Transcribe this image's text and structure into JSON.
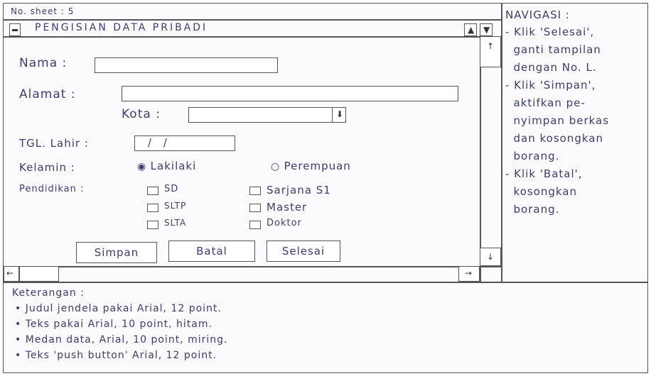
{
  "sheet": {
    "label": "No. sheet : 5"
  },
  "window": {
    "title": "PENGISIAN DATA PRIBADI"
  },
  "form": {
    "nama_label": "Nama :",
    "alamat_label": "Alamat :",
    "kota_label": "Kota :",
    "tgl_label": "TGL. Lahir :",
    "tgl_placeholder": "/ /",
    "kelamin_label": "Kelamin :",
    "gender_options": [
      "Lakilaki",
      "Perempuan"
    ],
    "gender_selected": "Lakilaki",
    "pendidikan_label": "Pendidikan :",
    "pendidikan_options": [
      "SD",
      "SLTP",
      "SLTA",
      "Sarjana S1",
      "Master",
      "Doktor"
    ]
  },
  "buttons": {
    "simpan": "Simpan",
    "batal": "Batal",
    "selesai": "Selesai"
  },
  "keterangan": {
    "title": "Keterangan :",
    "items": [
      "• Judul jendela pakai Arial, 12 point.",
      "• Teks pakai Arial, 10 point, hitam.",
      "• Medan data, Arial, 10 point, miring.",
      "• Teks 'push button' Arial, 12 point."
    ]
  },
  "navigasi": {
    "title": "NAVIGASI :",
    "lines": [
      "- Klik 'Selesai',",
      "  ganti tampilan",
      "  dengan No. L.",
      "- Klik 'Simpan',",
      "  aktifkan pe-",
      "  nyimpan berkas",
      "  dan kosongkan",
      "  borang.",
      "- Klik 'Batal',",
      "  kosongkan",
      "  borang."
    ]
  }
}
